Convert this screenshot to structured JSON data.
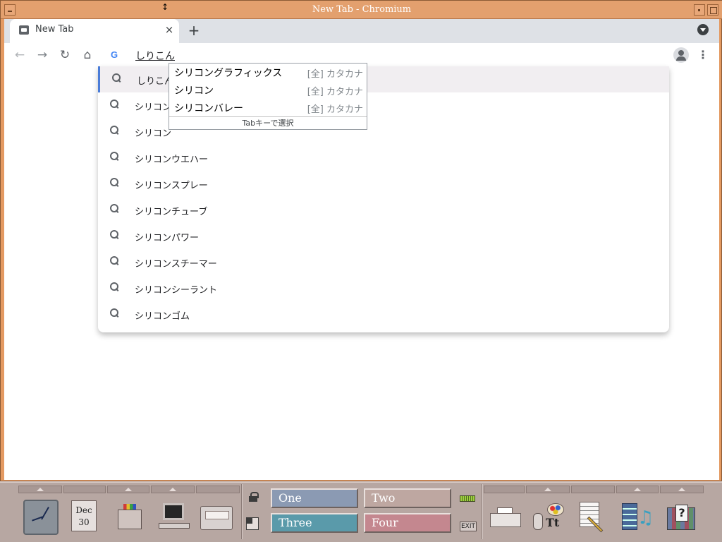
{
  "window": {
    "title": "New Tab - Chromium"
  },
  "tab": {
    "title": "New Tab",
    "close": "×",
    "new_tab": "+"
  },
  "toolbar": {
    "back": "←",
    "forward": "→",
    "reload": "↻",
    "home": "⌂",
    "omnibox_provider": "G",
    "omnibox_text": "しりこん",
    "menu": "⋮"
  },
  "suggestions": [
    "しりこん",
    "シリコン",
    "シリコン",
    "シリコンウエハー",
    "シリコンスプレー",
    "シリコンチューブ",
    "シリコンパワー",
    "シリコンスチーマー",
    "シリコンシーラント",
    "シリコンゴム"
  ],
  "ime": {
    "candidates": [
      {
        "word": "シリコングラフィックス",
        "type": "[全] カタカナ"
      },
      {
        "word": "シリコン",
        "type": "[全] カタカナ"
      },
      {
        "word": "シリコンバレー",
        "type": "[全] カタカナ"
      }
    ],
    "footer": "Tabキーで選択"
  },
  "panel": {
    "calendar": {
      "month": "Dec",
      "day": "30"
    },
    "workspaces": [
      "One",
      "Two",
      "Three",
      "Four"
    ],
    "exit_label": "EXIT",
    "help_glyph": "?",
    "style_glyph": "Tt",
    "note_glyph": "♫"
  },
  "colors": {
    "title_bar": "#e3a06e",
    "tab_strip": "#dee1e6",
    "selected_suggestion": "#f1eef1",
    "panel": "#b7a7a2",
    "ws_one": "#8b9ab3",
    "ws_two": "#bea7a1",
    "ws_three": "#5a9aaa",
    "ws_four": "#c4878f"
  }
}
